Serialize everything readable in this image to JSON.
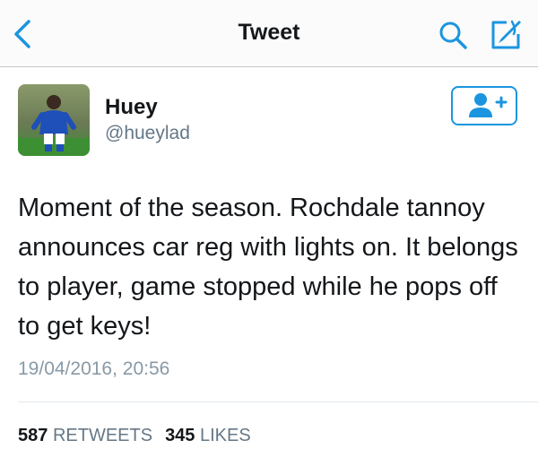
{
  "nav": {
    "title": "Tweet",
    "back_icon": "chevron-left-icon",
    "search_icon": "search-icon",
    "compose_icon": "compose-icon"
  },
  "author": {
    "name": "Huey",
    "handle": "@hueylad",
    "avatar_icon": "user-avatar",
    "follow_icon": "add-user-icon"
  },
  "tweet": {
    "text": "Moment of the season. Rochdale tannoy announces car reg with lights on. It belongs to player, game stopped while he pops off to get keys!",
    "timestamp": "19/04/2016, 20:56"
  },
  "stats": {
    "retweets_count": "587",
    "retweets_label": "RETWEETS",
    "likes_count": "345",
    "likes_label": "LIKES"
  },
  "colors": {
    "accent": "#1b95e0",
    "text": "#14171a",
    "secondary": "#657786",
    "timestamp": "#8899a6"
  }
}
